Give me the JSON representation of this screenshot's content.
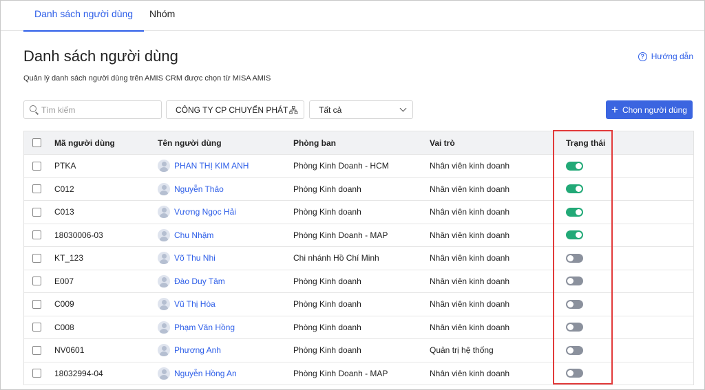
{
  "tabs": [
    {
      "label": "Danh sách người dùng",
      "active": true
    },
    {
      "label": "Nhóm",
      "active": false
    }
  ],
  "header": {
    "title": "Danh sách người dùng",
    "subtitle": "Quản lý danh sách người dùng trên AMIS CRM được chọn từ MISA AMIS",
    "help_label": "Hướng dẫn"
  },
  "toolbar": {
    "search_placeholder": "Tìm kiếm",
    "company_value": "CÔNG TY CP CHUYỂN PHÁT N...",
    "status_value": "Tất cả",
    "add_button_label": "Chọn người dùng"
  },
  "table": {
    "columns": {
      "code": "Mã người dùng",
      "name": "Tên người dùng",
      "dept": "Phòng ban",
      "role": "Vai trò",
      "status": "Trạng thái"
    },
    "rows": [
      {
        "code": "PTKA",
        "name": "PHAN THỊ KIM ANH",
        "dept": "Phòng Kinh Doanh - HCM",
        "role": "Nhân viên kinh doanh",
        "active": true
      },
      {
        "code": "C012",
        "name": "Nguyễn Thảo",
        "dept": "Phòng Kinh doanh",
        "role": "Nhân viên kinh doanh",
        "active": true
      },
      {
        "code": "C013",
        "name": "Vương Ngọc Hải",
        "dept": "Phòng Kinh doanh",
        "role": "Nhân viên kinh doanh",
        "active": true
      },
      {
        "code": "18030006-03",
        "name": "Chu Nhậm",
        "dept": "Phòng Kinh Doanh - MAP",
        "role": "Nhân viên kinh doanh",
        "active": true
      },
      {
        "code": "KT_123",
        "name": "Võ Thu Nhi",
        "dept": "Chi nhánh Hồ Chí Minh",
        "role": "Nhân viên kinh doanh",
        "active": false
      },
      {
        "code": "E007",
        "name": "Đào Duy Tâm",
        "dept": "Phòng Kinh doanh",
        "role": "Nhân viên kinh doanh",
        "active": false
      },
      {
        "code": "C009",
        "name": "Vũ Thị Hòa",
        "dept": "Phòng Kinh doanh",
        "role": "Nhân viên kinh doanh",
        "active": false
      },
      {
        "code": "C008",
        "name": "Phạm Văn Hồng",
        "dept": "Phòng Kinh doanh",
        "role": "Nhân viên kinh doanh",
        "active": false
      },
      {
        "code": "NV0601",
        "name": "Phương Anh",
        "dept": "Phòng Kinh doanh",
        "role": "Quản trị hệ thống",
        "active": false
      },
      {
        "code": "18032994-04",
        "name": "Nguyễn Hồng An",
        "dept": "Phòng Kinh Doanh - MAP",
        "role": "Nhân viên kinh doanh",
        "active": false
      }
    ]
  },
  "colors": {
    "accent": "#2d5ee8",
    "toggle_on": "#22a977",
    "toggle_off": "#8b919d",
    "highlight": "#e23a3a"
  }
}
